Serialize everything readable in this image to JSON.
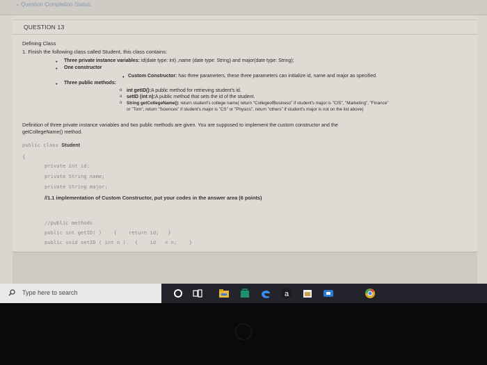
{
  "status_bar": {
    "caret": "⌄",
    "text": "Question Completion Status:"
  },
  "question": {
    "label": "QUESTION 13",
    "title": "Defining Class",
    "intro": "1. Finish the following class called Student, this class contains:",
    "items": {
      "private_vars": {
        "bold": "Three private instance variables:",
        "rest": " id(date type: int) ,name (date type: String) and major(date type: String);"
      },
      "constructor": "One constructor",
      "custom_constructor": {
        "bold": "Custom Constructor:",
        "rest": " has three parameters, these three parameters can initialize id, name and major as specified."
      },
      "public_methods": "Three public methods:",
      "get_id": {
        "bold": "int getID():",
        "rest": "A public method for retrieving student's id."
      },
      "set_id": {
        "bold": "setID (int n):",
        "rest": "A public method that sets the id of the student."
      },
      "get_college": {
        "bold": "String getCollegeName():",
        "rest": " return student's college name( return \"CollegeofBusiness\" if student's major is \"CIS\", \"Marketing\", \"Finance\""
      },
      "get_college_2": "or \"Tom\", return \"Sciences\" if student's major is \"CS\" or \"Physics\", return \"others\" if student's major is not on the list above)"
    },
    "definition_line1": "Definition of three private instance variables and two public methods are given. You are supposed to implement the custom constructor and the",
    "definition_line2": "getCollegeName() method."
  },
  "code": {
    "class_decl_kw": "public class",
    "class_name": "Student",
    "open_brace": "{",
    "var1": "private int id;",
    "var2": "private String name;",
    "var3": "private String major;",
    "task": "//1.1 implementation of Custom Constructor, put your codes in the answer area (6 points)",
    "comment": "//public methods",
    "method1": "public int getID( )    {    return id;   }",
    "method2": "public void setID ( int n ).  {    id   = n;    }"
  },
  "taskbar": {
    "search_placeholder": "Type here to search",
    "icons": [
      "search-icon",
      "cortana-icon",
      "task-view-icon",
      "file-explorer-icon",
      "store-icon",
      "edge-icon",
      "amazon-icon",
      "security-icon",
      "mail-icon",
      "chrome-icon"
    ]
  }
}
